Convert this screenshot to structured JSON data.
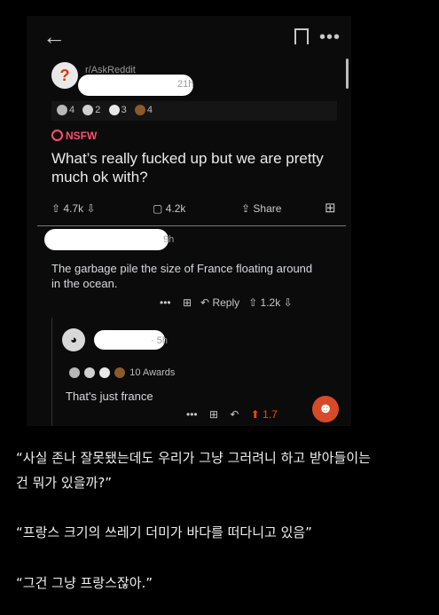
{
  "post": {
    "subreddit": "r/AskReddit",
    "age": "21h",
    "awards": [
      "4",
      "2",
      "3",
      "4"
    ],
    "nsfw_label": "NSFW",
    "title": "What’s really fucked up but we are pretty much ok with?",
    "upvotes": "4.7k",
    "comments": "4.2k",
    "share_label": "Share"
  },
  "comment1": {
    "age": "9h",
    "text": "The garbage pile the size of France floating around in the ocean.",
    "reply_label": "Reply",
    "votes": "1.2k"
  },
  "comment2": {
    "age": "5h",
    "awards_label": "10 Awards",
    "text": "That's just france",
    "votes": "1.7"
  },
  "captions": {
    "line1": "“사실 존나 잘못됐는데도 우리가 그냥 그러려니 하고 받아들이는",
    "line2": "건 뭐가 있을까?”",
    "line3": "“프랑스 크기의 쓰레기 더미가 바다를 떠다니고 있음”",
    "line4": "“그건 그냥 프랑스잖아.”"
  },
  "colors": {
    "nsfw": "#ff4f6d",
    "upvote_active": "#ff4500",
    "background": "#000000"
  },
  "icons": [
    "back-arrow-icon",
    "bookmark-icon",
    "more-icon",
    "upvote-icon",
    "downvote-icon",
    "comment-icon",
    "share-icon",
    "award-icon",
    "reply-icon",
    "snoo-avatar-icon"
  ]
}
